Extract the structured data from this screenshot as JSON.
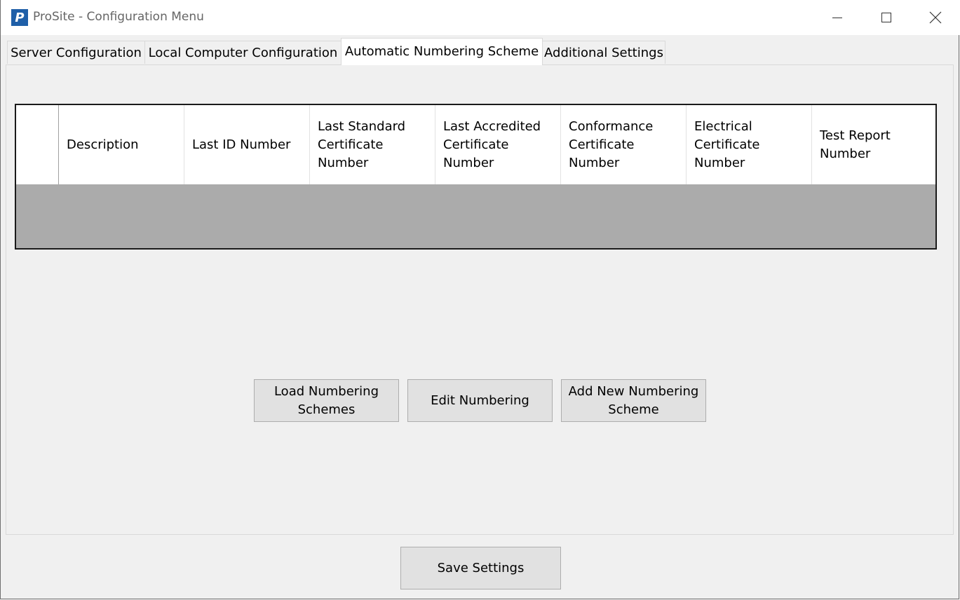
{
  "window": {
    "title": "ProSite - Configuration Menu",
    "app_icon_letter": "P"
  },
  "tabs": [
    {
      "label": "Server Configuration",
      "active": false
    },
    {
      "label": "Local Computer Configuration",
      "active": false
    },
    {
      "label": "Automatic Numbering Scheme",
      "active": true
    },
    {
      "label": "Additional Settings",
      "active": false
    }
  ],
  "grid": {
    "columns": [
      "",
      "Description",
      "Last ID Number",
      "Last Standard Certificate Number",
      "Last Accredited Certificate Number",
      "Conformance Certificate Number",
      "Electrical Certificate Number",
      "Test Report Number"
    ],
    "rows": []
  },
  "buttons": {
    "load": "Load Numbering Schemes",
    "edit": "Edit Numbering",
    "add": "Add New Numbering Scheme",
    "save": "Save Settings"
  },
  "colors": {
    "grid_empty_area": "#ababab",
    "app_icon": "#1f5fa8"
  }
}
